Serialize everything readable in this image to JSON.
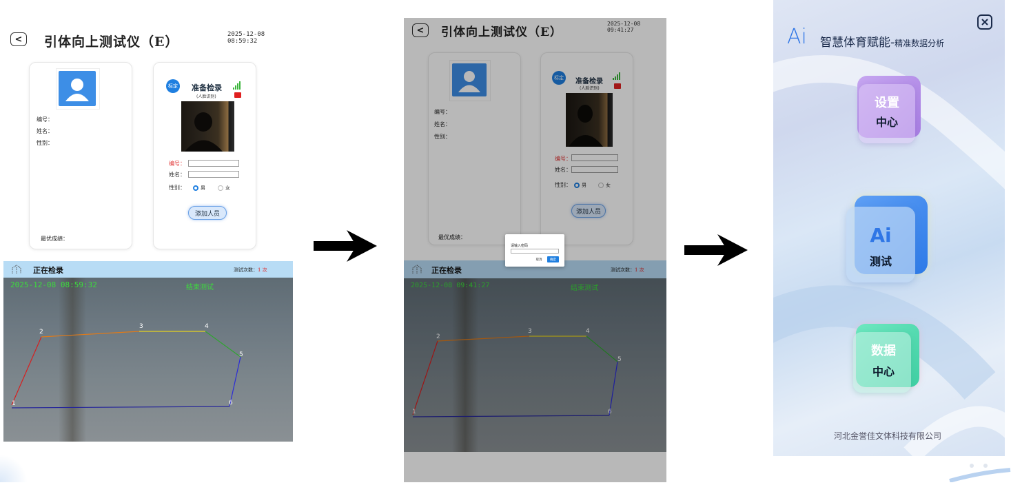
{
  "panel1": {
    "title": "引体向上测试仪（E）",
    "timestamp": "2025-12-08 08:59:32",
    "info": {
      "number_label": "编号：",
      "name_label": "姓名：",
      "gender_label": "性别：",
      "best_label": "最优成绩："
    },
    "check": {
      "badge": "标定",
      "ready": "准备检录",
      "ready_sub": "(人脸识别)"
    },
    "form": {
      "number_label": "编号：",
      "name_label": "姓名：",
      "gender_label": "性别：",
      "male": "男",
      "female": "女",
      "add_button": "添加人员"
    },
    "status": {
      "title": "正在检录",
      "count_label": "测试次数：",
      "count_value": "1 次"
    },
    "video": {
      "timestamp": "2025-12-08 08:59:32",
      "end_text": "结束测试"
    }
  },
  "panel2": {
    "title": "引体向上测试仪（E）",
    "timestamp": "2025-12-08 09:41:27",
    "info": {
      "number_label": "编号：",
      "name_label": "姓名：",
      "gender_label": "性别：",
      "best_label": "最优成绩："
    },
    "check": {
      "badge": "标定",
      "ready": "准备检录",
      "ready_sub": "(人脸识别)"
    },
    "form": {
      "number_label": "编号：",
      "name_label": "姓名：",
      "gender_label": "性别：",
      "male": "男",
      "female": "女",
      "add_button": "添加人员"
    },
    "dialog": {
      "title": "请输入密码",
      "cancel": "取消",
      "confirm": "确定"
    },
    "status": {
      "title": "正在检录",
      "count_label": "测试次数：",
      "count_value": "1 次"
    },
    "video": {
      "timestamp": "2025-12-08 09:41:27",
      "end_text": "结束测试"
    }
  },
  "points": [
    "1",
    "2",
    "3",
    "4",
    "5",
    "6"
  ],
  "app": {
    "logo": "Ai",
    "title": "智慧体育赋能-",
    "subtitle": "精准数据分析",
    "tiles": [
      {
        "line1": "设置",
        "line2": "中心"
      },
      {
        "line1": "Ai",
        "line2": "测试"
      },
      {
        "line1": "数据",
        "line2": "中心"
      }
    ],
    "company": "河北金誉佳文体科技有限公司"
  },
  "colors": {
    "accent_blue": "#1f7fe0",
    "status_green": "#3cdc3c",
    "count_red": "#e02020",
    "line_red": "#d81e1e",
    "line_orange": "#e07a18",
    "line_yellow": "#e6d21e",
    "line_green": "#2fa52f",
    "line_blue": "#2b2bd8",
    "line_navy": "#27279a"
  }
}
